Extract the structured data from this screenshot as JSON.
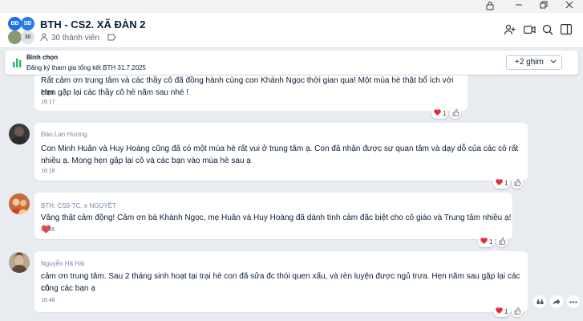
{
  "header": {
    "avatar_left_initials": "BĐ",
    "avatar_right_initials": "SĐ",
    "avatar_count": "30",
    "group_name": "BTH - CS2. XÃ ĐÀN 2",
    "member_count": "30 thành viên"
  },
  "pinned": {
    "title": "Bình chọn",
    "subtitle": "Đăng ký tham gia tổng kết BTH 31.7.2025",
    "more_label": "+2 ghim"
  },
  "messages": [
    {
      "sender": "",
      "lines": [
        "Rất cảm ơn trung tâm và các thầy cô đã đồng hành cùng con Khánh Ngọc thời gian qua! Một mùa hè thật bổ ích với con.",
        "Hẹn gặp lại các thầy cô hè năm sau nhé !"
      ],
      "time": "16:17",
      "heart_count": "1"
    },
    {
      "sender": "Đào Lan Hương",
      "lines": [
        "Con Minh Huân và Huy Hoàng cũng đã có một mùa hè rất vui ở trung tâm ạ. Con đã nhận được sự quan tâm và dạy dỗ của các cô rất",
        "nhiều ạ. Mong hẹn gặp lại cô và các bạn vào mùa hè sau ạ"
      ],
      "time": "16:18",
      "heart_count": "1"
    },
    {
      "sender": "BTH. CS9-TC. e NGUYỆT",
      "lines": [
        "Vâng thật cảm động! Cảm ơn bà Khánh Ngọc, mẹ Huân và Huy Hoàng đã dành tình cảm đặc biệt cho cô giáo và Trung tâm nhiều ạ! ❤️"
      ],
      "time": "16:36",
      "heart_count": "1"
    },
    {
      "sender": "Nguyễn Hà Hải",
      "lines": [
        "cảm ơn trung tâm. Sau 2 tháng sinh hoạt tại trại hè con đã sửa đc thói quen xấu, và rèn luyện được ngủ trưa. Hẹn năm sau gặp lại các cô",
        "cùng các bạn ạ"
      ],
      "time": "16:48",
      "heart_count": "1"
    }
  ],
  "colors": {
    "heart": "#e8293b",
    "accent": "#0068ff",
    "chat_bg": "#e8ebf0"
  }
}
